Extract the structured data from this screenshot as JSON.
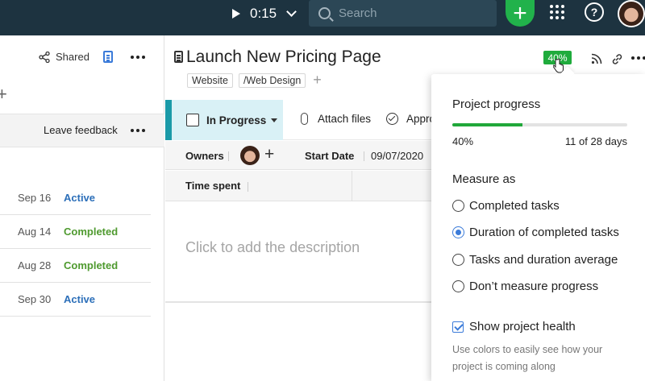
{
  "topbar": {
    "timer": "0:15",
    "search_placeholder": "Search"
  },
  "left_panel": {
    "shared_label": "Shared",
    "feedback_label": "Leave feedback",
    "rows": [
      {
        "date": "Sep 16",
        "status": "Active"
      },
      {
        "date": "Aug 14",
        "status": "Completed"
      },
      {
        "date": "Aug 28",
        "status": "Completed"
      },
      {
        "date": "Sep 30",
        "status": "Active"
      }
    ]
  },
  "task": {
    "title": "Launch New Pricing Page",
    "progress_badge": "40%",
    "tags": [
      "Website",
      "/Web Design"
    ],
    "status": "In Progress",
    "attach_label": "Attach files",
    "approve_label": "Appro",
    "owners_label": "Owners",
    "start_date_label": "Start Date",
    "start_date_value": "09/07/2020",
    "time_spent_label": "Time spent",
    "description_placeholder": "Click to add the description"
  },
  "progress_popover": {
    "title": "Project progress",
    "progress": 0.4,
    "percent_text": "40%",
    "days_text": "11 of 28 days",
    "measure_label": "Measure as",
    "options": [
      {
        "label": "Completed tasks",
        "selected": false
      },
      {
        "label": "Duration of completed tasks",
        "selected": true
      },
      {
        "label": "Tasks and duration average",
        "selected": false
      },
      {
        "label": "Don’t measure progress",
        "selected": false
      }
    ],
    "health_label": "Show project health",
    "health_checked": true,
    "health_hint": "Use colors to easily see how your project is coming along"
  },
  "colors": {
    "topbar": "#1d3340",
    "accent_green": "#21b24b",
    "active_blue": "#2c6fb9",
    "completed_green": "#4f9a2f",
    "status_teal": "#1a9aa8"
  }
}
